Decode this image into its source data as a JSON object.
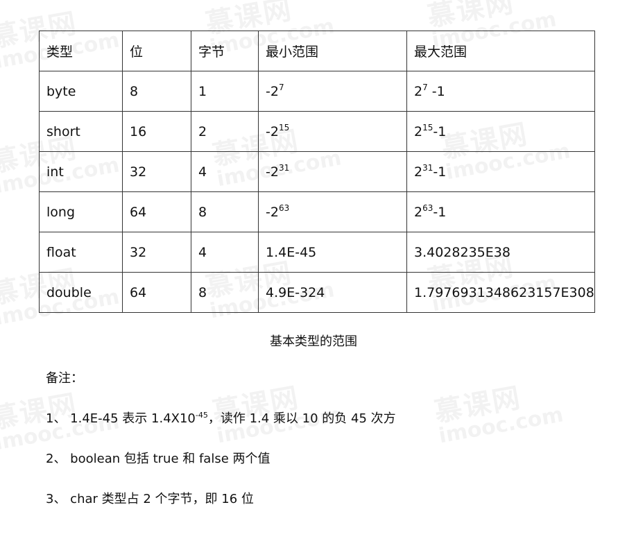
{
  "table": {
    "headers": [
      "类型",
      "位",
      "字节",
      "最小范围",
      "最大范围"
    ],
    "rows": [
      {
        "type": "byte",
        "bits": "8",
        "bytes": "1",
        "min_base": "-2",
        "min_exp": "7",
        "max_base": "2",
        "max_exp": "7",
        "max_suffix": "-1",
        "min_text": "",
        "max_text": ""
      },
      {
        "type": "short",
        "bits": "16",
        "bytes": "2",
        "min_base": "-2",
        "min_exp": "15",
        "max_base": "2",
        "max_exp": "15",
        "max_suffix": "-1",
        "min_text": "",
        "max_text": ""
      },
      {
        "type": "int",
        "bits": "32",
        "bytes": "4",
        "min_base": "-2",
        "min_exp": "31",
        "max_base": "2",
        "max_exp": "31",
        "max_suffix": "-1",
        "min_text": "",
        "max_text": ""
      },
      {
        "type": "long",
        "bits": "64",
        "bytes": "8",
        "min_base": "-2",
        "min_exp": "63",
        "max_base": "2",
        "max_exp": "63",
        "max_suffix": "-1",
        "min_text": "",
        "max_text": ""
      },
      {
        "type": "float",
        "bits": "32",
        "bytes": "4",
        "min_base": "",
        "min_exp": "",
        "max_base": "",
        "max_exp": "",
        "max_suffix": "",
        "min_text": "1.4E-45",
        "max_text": "3.4028235E38"
      },
      {
        "type": "double",
        "bits": "64",
        "bytes": "8",
        "min_base": "",
        "min_exp": "",
        "max_base": "",
        "max_exp": "",
        "max_suffix": "",
        "min_text": "4.9E-324",
        "max_text": "1.7976931348623157E308"
      }
    ]
  },
  "caption": "基本类型的范围",
  "notes": {
    "label": "备注：",
    "note1": {
      "prefix": "1、 1.4E-45 表示 1.4X10",
      "exp": "-45",
      "suffix": "，读作 1.4 乘以 10 的负 45 次方"
    },
    "note2": "2、 boolean 包括 true 和 false 两个值",
    "note3": "3、 char 类型占 2 个字节，即 16 位"
  },
  "watermark": {
    "cn": "慕课网",
    "en": "imooc.com",
    "color": "#000000"
  }
}
